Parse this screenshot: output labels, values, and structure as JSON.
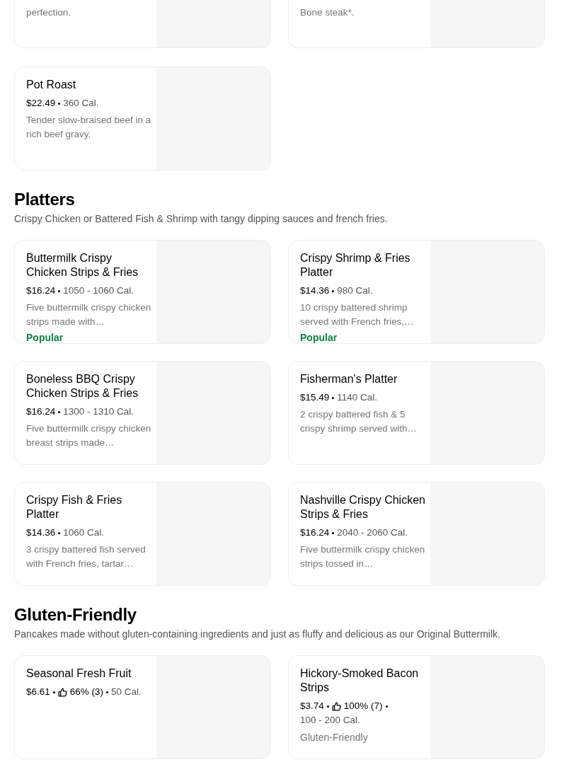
{
  "sections": [
    {
      "cut_top": true,
      "items": [
        {
          "description": "perfection."
        },
        {
          "description": "Bone steak*."
        }
      ]
    },
    {
      "items": [
        {
          "name": "Pot Roast",
          "price": "$22.49",
          "calories": "360 Cal.",
          "description": "Tender slow-braised beef in a rich beef gravy."
        }
      ]
    },
    {
      "title": "Platters",
      "subtitle": "Crispy Chicken or Battered Fish & Shrimp with tangy dipping sauces and french fries.",
      "items": [
        {
          "name": "Buttermilk Crispy Chicken Strips & Fries",
          "price": "$16.24",
          "calories": "1050 - 1060 Cal.",
          "description": "Five buttermilk crispy chicken strips made with…",
          "tag": {
            "text": "Popular",
            "kind": "popular"
          }
        },
        {
          "name": "Crispy Shrimp & Fries Platter",
          "price": "$14.36",
          "calories": "980 Cal.",
          "description": "10 crispy battered shrimp served with French fries,…",
          "tag": {
            "text": "Popular",
            "kind": "popular"
          }
        },
        {
          "name": "Boneless BBQ Crispy Chicken Strips & Fries",
          "price": "$16.24",
          "calories": "1300 - 1310 Cal.",
          "description": "Five buttermilk crispy chicken breast strips made…"
        },
        {
          "name": "Fisherman's Platter",
          "price": "$15.49",
          "calories": "1140 Cal.",
          "description": "2 crispy battered fish & 5 crispy shrimp served with…"
        },
        {
          "name": "Crispy Fish & Fries Platter",
          "price": "$14.36",
          "calories": "1060 Cal.",
          "description": "3 crispy battered fish served with French fries, tartar…"
        },
        {
          "name": "Nashville Crispy Chicken Strips & Fries",
          "price": "$16.24",
          "calories": "2040 - 2060 Cal.",
          "description": "Five buttermilk crispy chicken strips tossed in…"
        }
      ]
    },
    {
      "title": "Gluten-Friendly",
      "subtitle": "Pancakes made without gluten-containing ingredients and just as fluffy and delicious as our Original Buttermilk.",
      "items": [
        {
          "name": "Seasonal Fresh Fruit",
          "price": "$6.61",
          "rating": "66% (3)",
          "calories": "50 Cal."
        },
        {
          "name": "Hickory-Smoked Bacon Strips",
          "price": "$3.74",
          "rating": "100% (7)",
          "calories": "100 - 200 Cal.",
          "tag": {
            "text": "Gluten-Friendly",
            "kind": "dietary"
          }
        }
      ]
    }
  ]
}
